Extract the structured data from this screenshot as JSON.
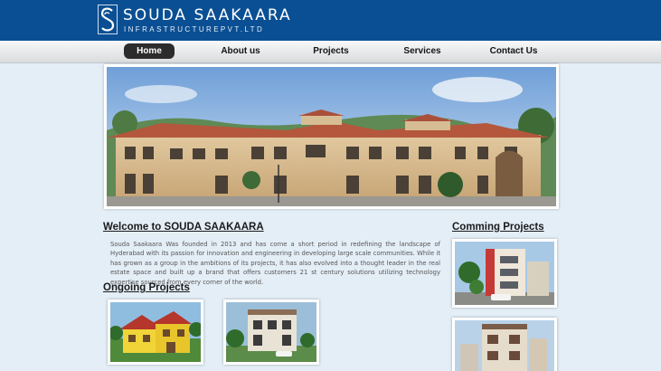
{
  "brand": {
    "name": "SOUDA SAAKAARA",
    "tagline": "INFRASTRUCTUREPVT.LTD",
    "mark": "S"
  },
  "nav": {
    "items": [
      {
        "label": "Home",
        "active": true
      },
      {
        "label": "About us",
        "active": false
      },
      {
        "label": "Projects",
        "active": false
      },
      {
        "label": "Services",
        "active": false
      },
      {
        "label": "Contact Us",
        "active": false
      }
    ]
  },
  "hero": {
    "icon": "building-photo"
  },
  "welcome": {
    "title": "Welcome to SOUDA SAAKAARA",
    "body": "Souda Saakaara Was founded in 2013 and has come a short period in redefining the landscape of Hyderabad with its passion for innovation and engineering in developing large scale communities. While it has grown as a group in the ambitions of its projects, it has also evolved into a thought leader in the real estate space and built up a brand that offers customers 21 st century solutions utilizing technology expertise sourced from every corner of the world."
  },
  "ongoing": {
    "title": "Ongoing Projects"
  },
  "upcoming": {
    "title": "Comming Projects"
  },
  "colors": {
    "header": "#0a4f93",
    "page": "#e4eef7",
    "nav_active": "#2c2c2c"
  }
}
